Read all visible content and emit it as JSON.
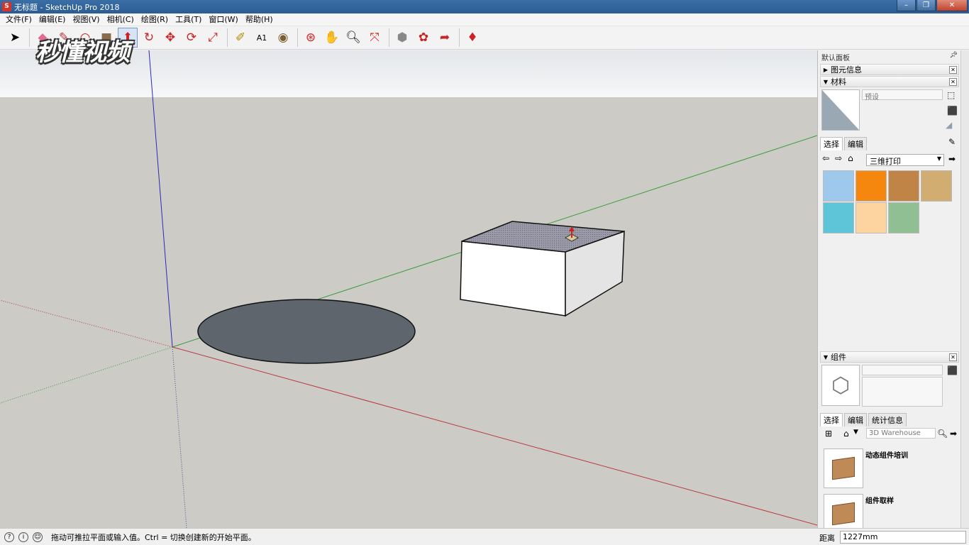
{
  "window": {
    "title": "无标题 - SketchUp Pro 2018",
    "app_icon": "S",
    "minimize": "–",
    "maximize": "❐",
    "close": "✕"
  },
  "menu": [
    "文件(F)",
    "编辑(E)",
    "视图(V)",
    "相机(C)",
    "绘图(R)",
    "工具(T)",
    "窗口(W)",
    "帮助(H)"
  ],
  "watermark": "秒懂视频",
  "panel": {
    "title": "默认面板",
    "entity_info": {
      "label": "图元信息"
    },
    "materials": {
      "label": "材料",
      "name_placeholder": "预设",
      "tabs": [
        "选择",
        "编辑"
      ],
      "library": "三维打印",
      "colors": [
        "#9ec8ec",
        "#f5870f",
        "#c08446",
        "#d2ad72",
        "#5ec4d8",
        "#fdd3a0",
        "#8fbf93"
      ]
    },
    "components": {
      "label": "组件",
      "tabs": [
        "选择",
        "编辑",
        "统计信息"
      ],
      "search_placeholder": "3D Warehouse",
      "items": [
        "动态组件培训",
        "组件取样"
      ]
    }
  },
  "status": {
    "message": "拖动可推拉平面或输入值。Ctrl = 切换创建新的开始平面。",
    "vcb_label": "距离",
    "vcb_value": "1227mm"
  }
}
